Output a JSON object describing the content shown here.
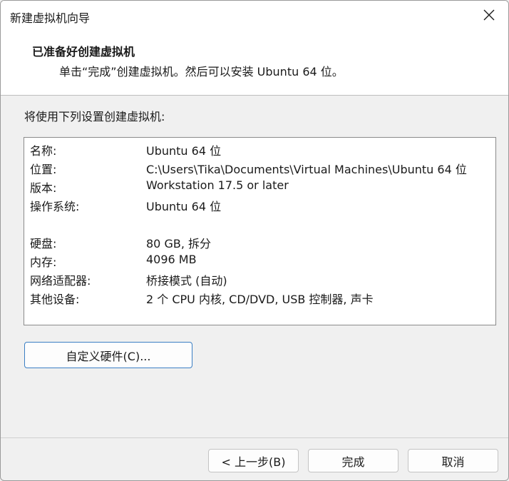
{
  "window": {
    "title": "新建虚拟机向导",
    "close_icon": "close-icon"
  },
  "header": {
    "title": "已准备好创建虚拟机",
    "subtitle": "单击“完成”创建虚拟机。然后可以安装 Ubuntu 64 位。"
  },
  "summary": {
    "label": "将使用下列设置创建虚拟机:",
    "rows": [
      {
        "key": "名称:",
        "value": "Ubuntu 64 位"
      },
      {
        "key": "位置:",
        "value": "C:\\Users\\Tika\\Documents\\Virtual Machines\\Ubuntu 64 位"
      },
      {
        "key": "版本:",
        "value": "Workstation 17.5 or later"
      },
      {
        "key": "操作系统:",
        "value": "Ubuntu 64 位"
      },
      {
        "key": "硬盘:",
        "value": "80 GB, 拆分"
      },
      {
        "key": "内存:",
        "value": "4096 MB"
      },
      {
        "key": "网络适配器:",
        "value": "桥接模式 (自动)"
      },
      {
        "key": "其他设备:",
        "value": "2 个 CPU 内核, CD/DVD, USB 控制器, 声卡"
      }
    ]
  },
  "buttons": {
    "customize": "自定义硬件(C)...",
    "back": "< 上一步(B)",
    "finish": "完成",
    "cancel": "取消"
  },
  "colors": {
    "accent_border": "#3b7fc4",
    "window_bg": "#f0f0f0",
    "header_bg": "#ffffff"
  }
}
